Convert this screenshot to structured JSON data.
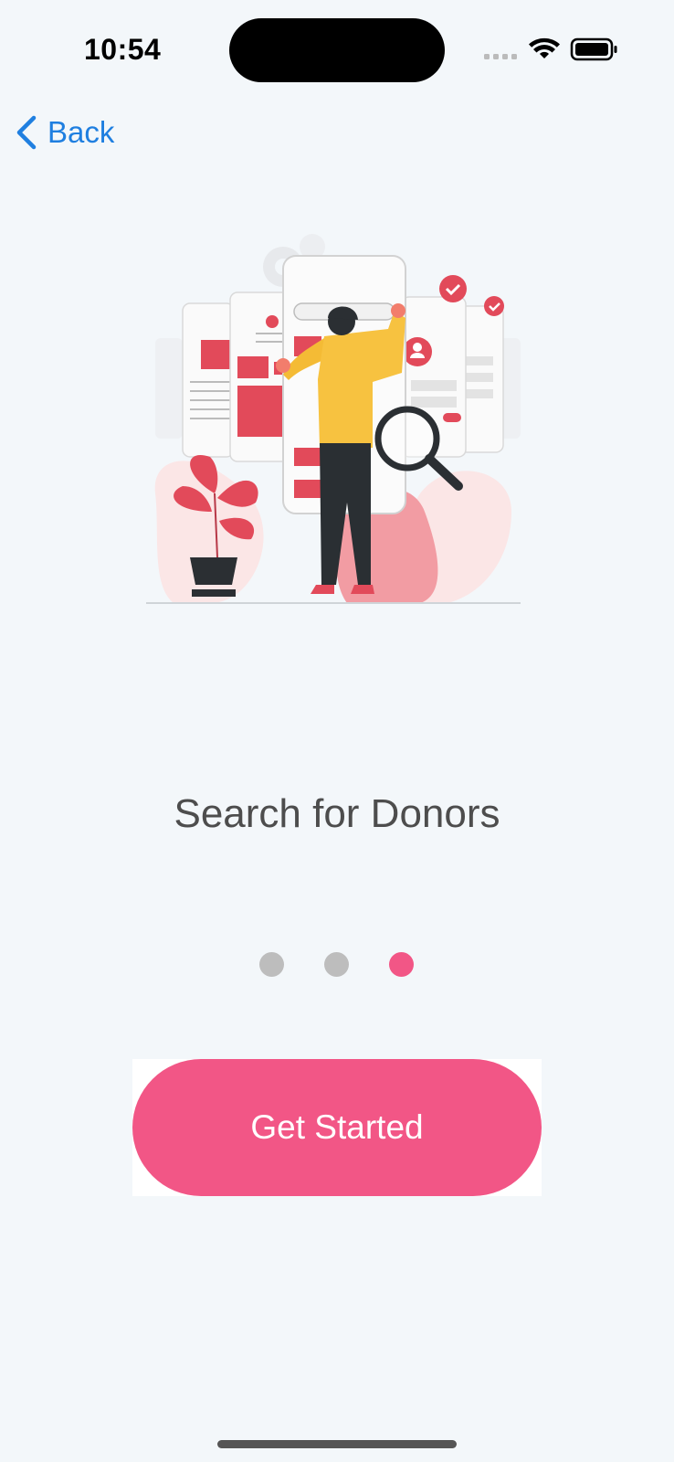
{
  "status_bar": {
    "time": "10:54",
    "icons": [
      "signal-dots-icon",
      "wifi-icon",
      "battery-icon"
    ]
  },
  "nav": {
    "back_label": "Back",
    "back_icon": "chevron-left-icon"
  },
  "illustration": {
    "icon": "person-searching-donors-illustration"
  },
  "onboarding": {
    "title": "Search for Donors",
    "page_count": 3,
    "active_page": 3
  },
  "cta": {
    "label": "Get Started"
  },
  "colors": {
    "background": "#f3f7fa",
    "accent": "#f25686",
    "link": "#1f7fe0",
    "title": "#4d4d4d",
    "dot_inactive": "#bdbdbd",
    "dot_active": "#f25686"
  }
}
